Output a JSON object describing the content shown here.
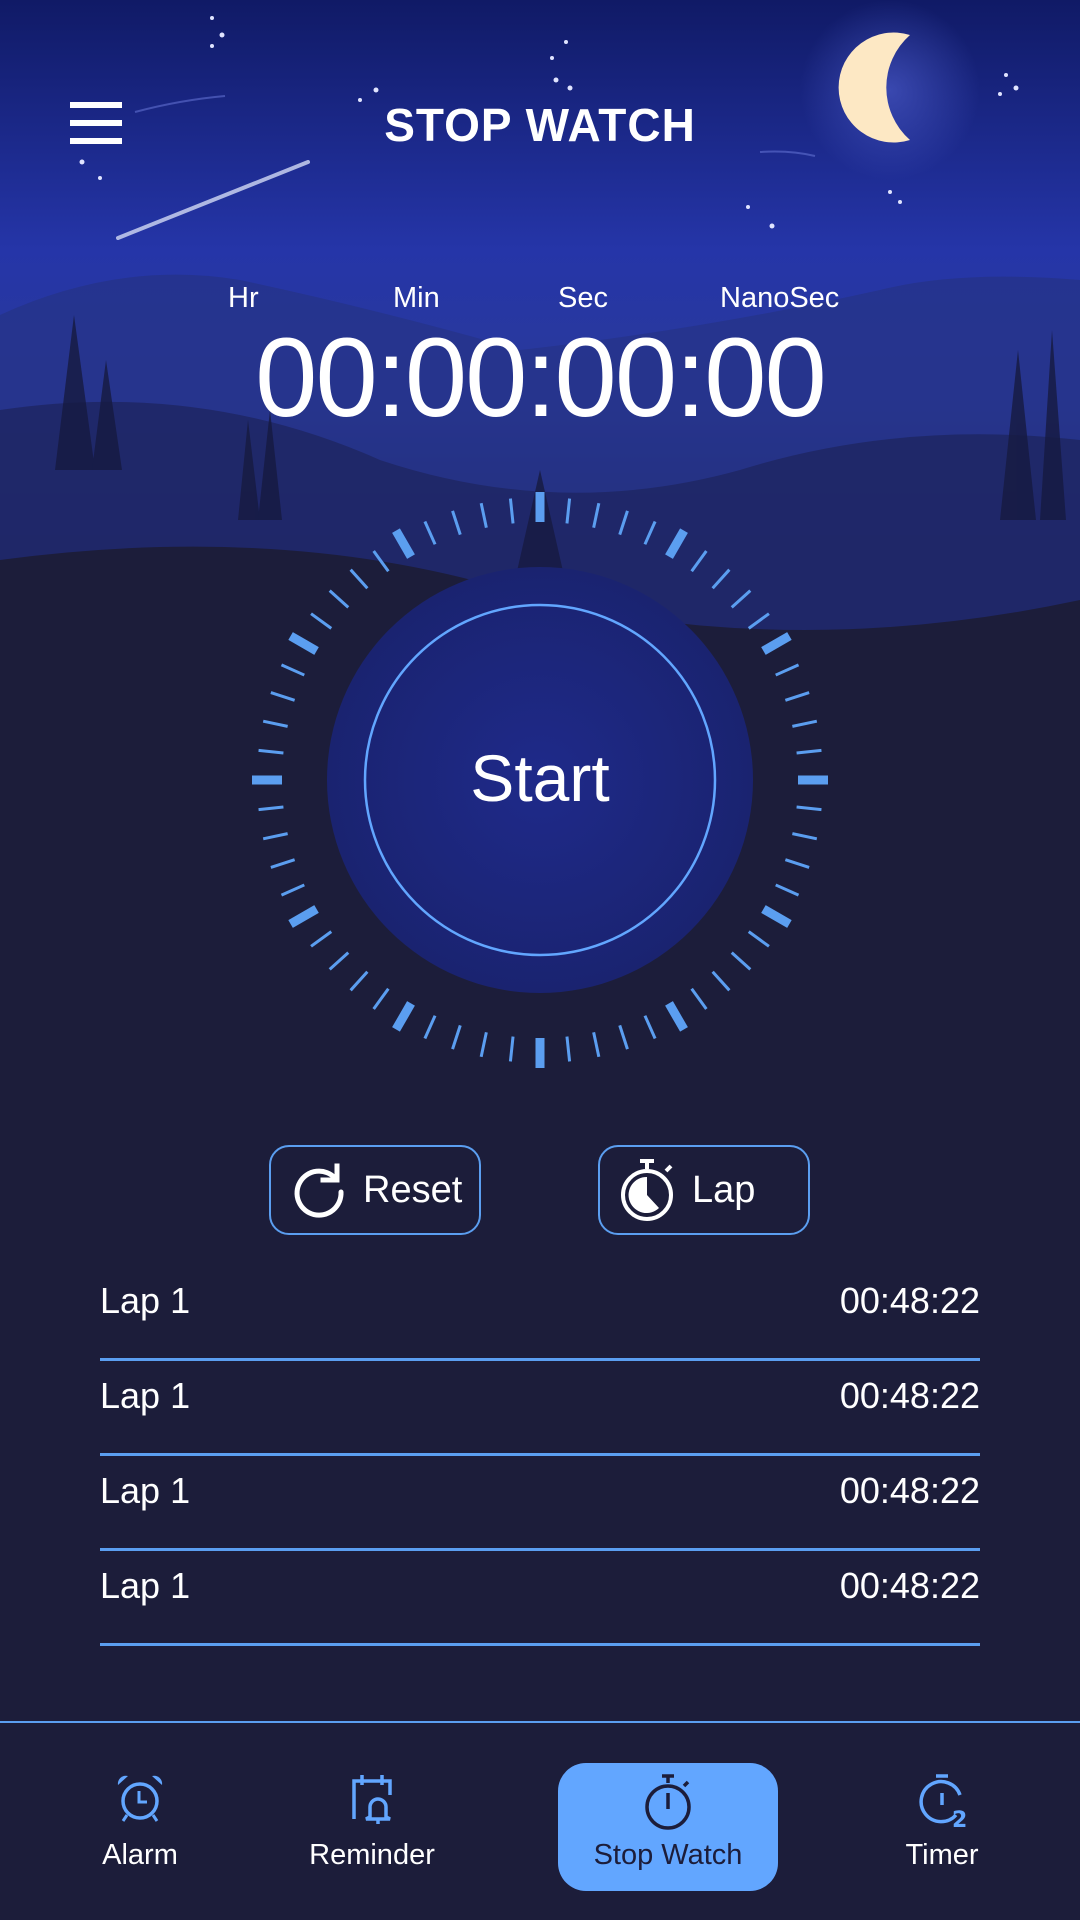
{
  "header": {
    "title": "STOP WATCH",
    "menu_icon": "hamburger-menu-icon"
  },
  "display": {
    "units": [
      "Hr",
      "Min",
      "Sec",
      "NanoSec"
    ],
    "time": "00:00:00:00"
  },
  "dial": {
    "start_label": "Start",
    "tick_count": 60,
    "major_every": 5,
    "accent_color": "#5b9ef0"
  },
  "controls": {
    "reset_label": "Reset",
    "reset_icon": "refresh-icon",
    "lap_label": "Lap",
    "lap_icon": "stopwatch-icon"
  },
  "laps": [
    {
      "name": "Lap 1",
      "time": "00:48:22"
    },
    {
      "name": "Lap 1",
      "time": "00:48:22"
    },
    {
      "name": "Lap 1",
      "time": "00:48:22"
    },
    {
      "name": "Lap 1",
      "time": "00:48:22"
    }
  ],
  "nav": {
    "items": [
      {
        "label": "Alarm",
        "icon": "alarm-clock-icon",
        "active": false
      },
      {
        "label": "Reminder",
        "icon": "calendar-bell-icon",
        "active": false
      },
      {
        "label": "Stop Watch",
        "icon": "stopwatch-icon",
        "active": true
      },
      {
        "label": "Timer",
        "icon": "timer-icon",
        "active": false
      }
    ],
    "active_color": "#62a6ff"
  }
}
